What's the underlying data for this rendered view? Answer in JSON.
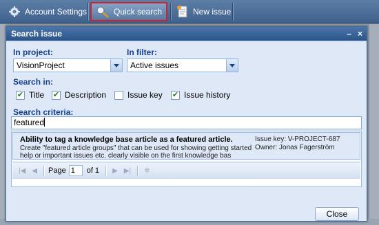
{
  "toolbar": {
    "items": [
      {
        "label": "Account Settings",
        "icon": "gear-icon"
      },
      {
        "label": "Quick search",
        "icon": "search-icon"
      },
      {
        "label": "New issue",
        "icon": "document-icon"
      }
    ]
  },
  "dialog": {
    "title": "Search issue",
    "tools": {
      "minimize": "–",
      "close": "×"
    },
    "project": {
      "label": "In project:",
      "value": "VisionProject"
    },
    "filter": {
      "label": "In filter:",
      "value": "Active issues"
    },
    "search_in": {
      "label": "Search in:",
      "options": [
        {
          "label": "Title",
          "checked": true
        },
        {
          "label": "Description",
          "checked": true
        },
        {
          "label": "Issue key",
          "checked": false
        },
        {
          "label": "Issue history",
          "checked": true
        }
      ]
    },
    "criteria": {
      "label": "Search criteria:",
      "value": "featured"
    },
    "results": [
      {
        "title": "Ability to tag a knowledge base article as a featured article.",
        "description": "Create \"featured article groups\" that can be used for showing getting started help or important issues etc. clearly visible on the first knowledge bas",
        "issue_key": "Issue key: V-PROJECT-687",
        "owner": "Owner: Jonas Fagerström"
      }
    ],
    "pager": {
      "page_label": "Page",
      "page_value": "1",
      "of_label": "of 1"
    },
    "close_label": "Close"
  }
}
